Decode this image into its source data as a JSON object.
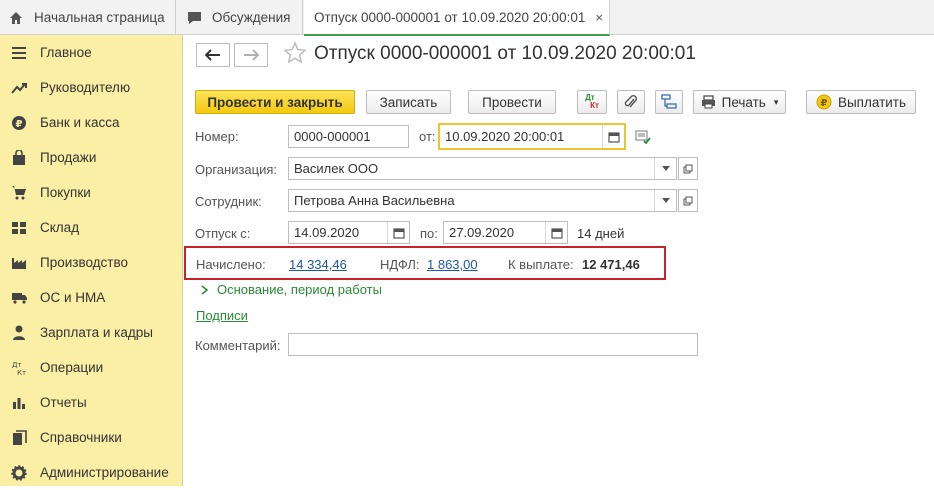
{
  "tabs": {
    "home_label": "Начальная страница",
    "discussions_label": "Обсуждения",
    "document_label": "Отпуск 0000-000001 от 10.09.2020 20:00:01",
    "close_glyph": "×"
  },
  "sidebar": {
    "items": [
      {
        "label": "Главное",
        "icon": "menu-icon"
      },
      {
        "label": "Руководителю",
        "icon": "trend-icon"
      },
      {
        "label": "Банк и касса",
        "icon": "ruble-icon"
      },
      {
        "label": "Продажи",
        "icon": "bag-icon"
      },
      {
        "label": "Покупки",
        "icon": "cart-icon"
      },
      {
        "label": "Склад",
        "icon": "warehouse-icon"
      },
      {
        "label": "Производство",
        "icon": "factory-icon"
      },
      {
        "label": "ОС и НМА",
        "icon": "truck-icon"
      },
      {
        "label": "Зарплата и кадры",
        "icon": "person-icon"
      },
      {
        "label": "Операции",
        "icon": "dt-kt-icon"
      },
      {
        "label": "Отчеты",
        "icon": "bar-chart-icon"
      },
      {
        "label": "Справочники",
        "icon": "books-icon"
      },
      {
        "label": "Администрирование",
        "icon": "gear-icon"
      }
    ]
  },
  "header": {
    "title": "Отпуск 0000-000001 от 10.09.2020 20:00:01"
  },
  "toolbar": {
    "post_and_close": "Провести и закрыть",
    "save": "Записать",
    "post": "Провести",
    "dt_kt_top": "Дт",
    "dt_kt_bottom": "Кт",
    "print": "Печать",
    "pay": "Выплатить"
  },
  "form": {
    "number_label": "Номер:",
    "number_value": "0000-000001",
    "date_from_label": "от:",
    "date_value": "10.09.2020 20:00:01",
    "organization_label": "Организация:",
    "organization_value": "Василек ООО",
    "employee_label": "Сотрудник:",
    "employee_value": "Петрова Анна Васильевна",
    "vacation_from_label": "Отпуск с:",
    "vacation_from_value": "14.09.2020",
    "vacation_to_label": "по:",
    "vacation_to_value": "27.09.2020",
    "days_text": "14 дней",
    "accrued_label": "Начислено:",
    "accrued_value": "14 334,46",
    "ndfl_label": "НДФЛ:",
    "ndfl_value": "1 863,00",
    "payout_label": "К выплате:",
    "payout_value": "12 471,46",
    "basis_label": "Основание, период работы",
    "signatures_link": "Подписи",
    "comment_label": "Комментарий:",
    "comment_value": ""
  },
  "colors": {
    "sidebar_bg": "#fbefa6",
    "primary_button": "#f3c90f",
    "highlight_border": "#c8232c",
    "link": "#1f56a6",
    "active_tab_underline": "#3d9d48"
  }
}
